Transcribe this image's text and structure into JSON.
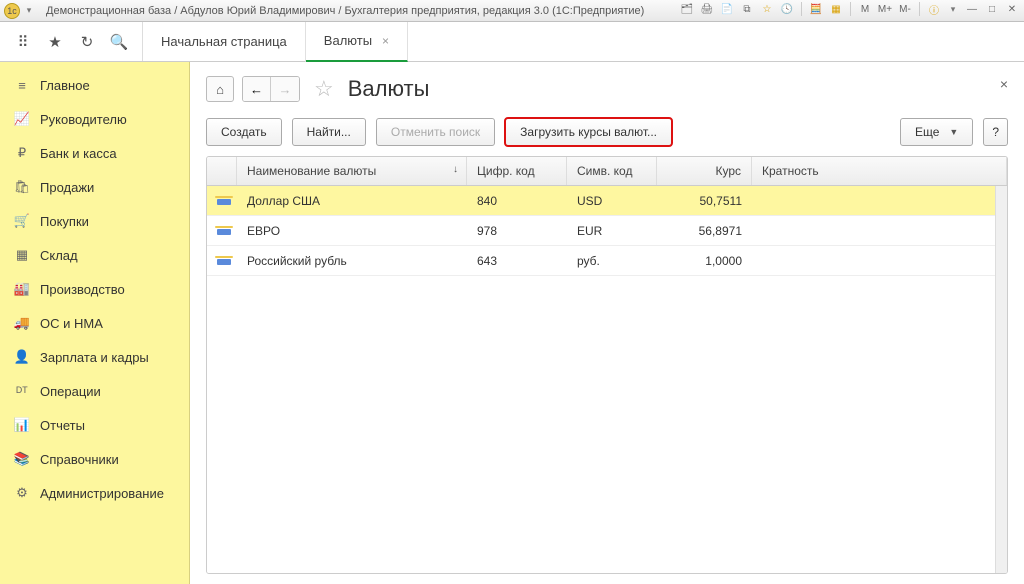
{
  "window_title": "Демонстрационная база / Абдулов Юрий Владимирович / Бухгалтерия предприятия, редакция 3.0  (1С:Предприятие)",
  "titlebar_right": {
    "m": "M",
    "mplus": "M+",
    "mminus": "M-"
  },
  "tabs": {
    "start": "Начальная страница",
    "active": "Валюты"
  },
  "sidebar": {
    "items": [
      {
        "icon": "≡",
        "label": "Главное"
      },
      {
        "icon": "📈",
        "label": "Руководителю"
      },
      {
        "icon": "₽",
        "label": "Банк и касса"
      },
      {
        "icon": "🛍",
        "label": "Продажи"
      },
      {
        "icon": "🛒",
        "label": "Покупки"
      },
      {
        "icon": "▦",
        "label": "Склад"
      },
      {
        "icon": "🏭",
        "label": "Производство"
      },
      {
        "icon": "🚚",
        "label": "ОС и НМА"
      },
      {
        "icon": "👤",
        "label": "Зарплата и кадры"
      },
      {
        "icon": "ᴰᵀ",
        "label": "Операции"
      },
      {
        "icon": "📊",
        "label": "Отчеты"
      },
      {
        "icon": "📚",
        "label": "Справочники"
      },
      {
        "icon": "⚙",
        "label": "Администрирование"
      }
    ]
  },
  "page": {
    "title": "Валюты",
    "toolbar": {
      "create": "Создать",
      "find": "Найти...",
      "cancel_find": "Отменить поиск",
      "load_rates": "Загрузить курсы валют...",
      "more": "Еще",
      "help": "?"
    },
    "columns": {
      "name": "Наименование валюты",
      "num": "Цифр. код",
      "sym": "Симв. код",
      "rate": "Курс",
      "mul": "Кратность"
    },
    "rows": [
      {
        "name": "Доллар США",
        "num": "840",
        "sym": "USD",
        "rate": "50,7511",
        "selected": true
      },
      {
        "name": "ЕВРО",
        "num": "978",
        "sym": "EUR",
        "rate": "56,8971",
        "selected": false
      },
      {
        "name": "Российский рубль",
        "num": "643",
        "sym": "руб.",
        "rate": "1,0000",
        "selected": false
      }
    ]
  }
}
